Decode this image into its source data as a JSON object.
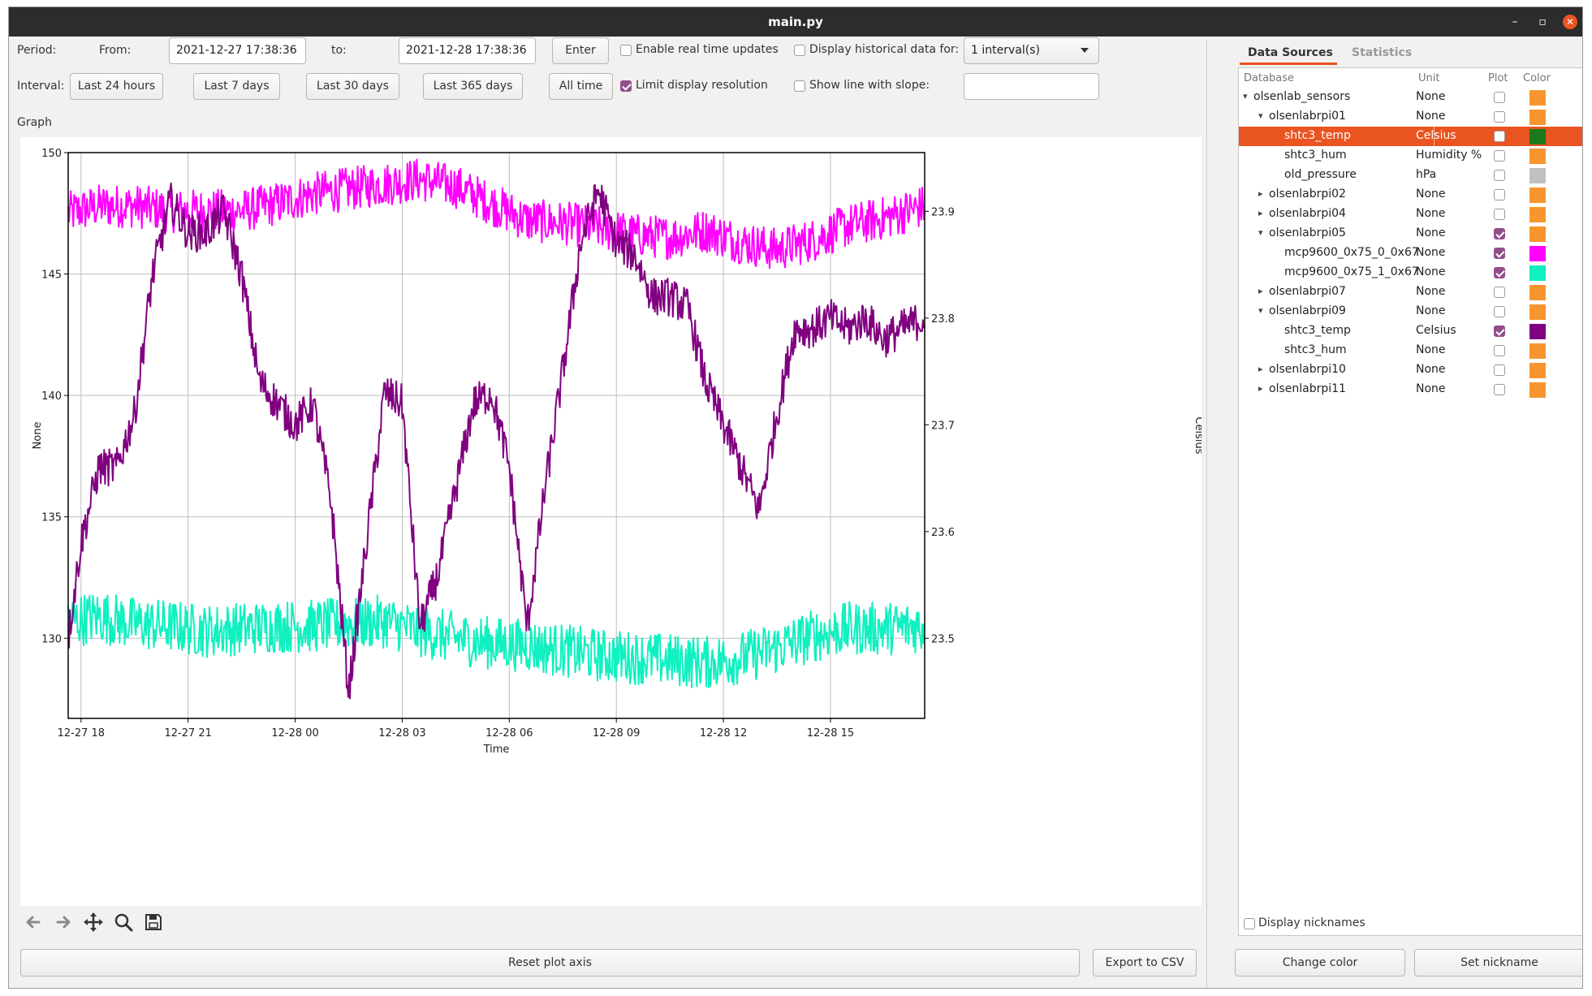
{
  "window": {
    "title": "main.py",
    "min_glyph": "–",
    "max_glyph": "▫",
    "close_glyph": "✕"
  },
  "controls": {
    "period_label": "Period:",
    "from_label": "From:",
    "from_value": "2021-12-27 17:38:36",
    "to_label": "to:",
    "to_value": "2021-12-28 17:38:36",
    "enter_label": "Enter",
    "realtime_label": "Enable real time updates",
    "realtime_checked": false,
    "historical_label": "Display historical data for:",
    "historical_checked": false,
    "historical_value": "1 interval(s)",
    "interval_label": "Interval:",
    "interval_buttons": [
      "Last 24 hours",
      "Last 7 days",
      "Last 30 days",
      "Last 365 days",
      "All time"
    ],
    "limit_label": "Limit display resolution",
    "limit_checked": true,
    "slope_label": "Show line with slope:",
    "slope_checked": false,
    "slope_value": "",
    "graph_label": "Graph"
  },
  "toolbar": {
    "icons": [
      "back-arrow-icon",
      "forward-arrow-icon",
      "pan-icon",
      "zoom-icon",
      "save-icon"
    ]
  },
  "buttons": {
    "reset_label": "Reset plot axis",
    "export_label": "Export to CSV",
    "change_color_label": "Change color",
    "set_nickname_label": "Set nickname"
  },
  "panel": {
    "tabs": [
      "Data Sources",
      "Statistics"
    ],
    "active_tab": 0,
    "columns": [
      "Database",
      "Unit",
      "Plot",
      "Color"
    ],
    "rows": [
      {
        "name": "olsenlab_sensors",
        "unit": "None",
        "level": 0,
        "arrow": "down",
        "plot": false,
        "color": "#f7962f"
      },
      {
        "name": "olsenlabrpi01",
        "unit": "None",
        "level": 1,
        "arrow": "down",
        "plot": false,
        "color": "#f7962f"
      },
      {
        "name": "shtc3_temp",
        "unit": "Celsius",
        "level": 2,
        "arrow": "",
        "plot": false,
        "color": "#1b7a1b",
        "selected": true
      },
      {
        "name": "shtc3_hum",
        "unit": "Humidity %",
        "level": 2,
        "arrow": "",
        "plot": false,
        "color": "#f7962f"
      },
      {
        "name": "old_pressure",
        "unit": "hPa",
        "level": 2,
        "arrow": "",
        "plot": false,
        "color": "#c0c0c0"
      },
      {
        "name": "olsenlabrpi02",
        "unit": "None",
        "level": 1,
        "arrow": "right",
        "plot": false,
        "color": "#f7962f"
      },
      {
        "name": "olsenlabrpi04",
        "unit": "None",
        "level": 1,
        "arrow": "right",
        "plot": false,
        "color": "#f7962f"
      },
      {
        "name": "olsenlabrpi05",
        "unit": "None",
        "level": 1,
        "arrow": "down",
        "plot": true,
        "color": "#f7962f"
      },
      {
        "name": "mcp9600_0x75_0_0x67",
        "unit": "None",
        "level": 2,
        "arrow": "",
        "plot": true,
        "color": "#ff00ff"
      },
      {
        "name": "mcp9600_0x75_1_0x67",
        "unit": "None",
        "level": 2,
        "arrow": "",
        "plot": true,
        "color": "#10f0c0"
      },
      {
        "name": "olsenlabrpi07",
        "unit": "None",
        "level": 1,
        "arrow": "right",
        "plot": false,
        "color": "#f7962f"
      },
      {
        "name": "olsenlabrpi09",
        "unit": "None",
        "level": 1,
        "arrow": "down",
        "plot": false,
        "color": "#f7962f"
      },
      {
        "name": "shtc3_temp",
        "unit": "Celsius",
        "level": 2,
        "arrow": "",
        "plot": true,
        "color": "#800080"
      },
      {
        "name": "shtc3_hum",
        "unit": "None",
        "level": 2,
        "arrow": "",
        "plot": false,
        "color": "#f7962f"
      },
      {
        "name": "olsenlabrpi10",
        "unit": "None",
        "level": 1,
        "arrow": "right",
        "plot": false,
        "color": "#f7962f"
      },
      {
        "name": "olsenlabrpi11",
        "unit": "None",
        "level": 1,
        "arrow": "right",
        "plot": false,
        "color": "#f7962f"
      }
    ],
    "nicknames_label": "Display nicknames",
    "nicknames_checked": false
  },
  "chart_data": {
    "type": "line",
    "xlabel": "Time",
    "ylabel": "None",
    "y2label": "Celsius",
    "x_ticks": [
      "12-27 18",
      "12-27 21",
      "12-28 00",
      "12-28 03",
      "12-28 06",
      "12-28 09",
      "12-28 12",
      "12-28 15"
    ],
    "x_range_hours": [
      17.64,
      41.64
    ],
    "x_tick_hours": [
      18,
      21,
      24,
      27,
      30,
      33,
      36,
      39
    ],
    "ylim": [
      126.7,
      150
    ],
    "y_ticks": [
      130,
      135,
      140,
      145,
      150
    ],
    "y2lim": [
      23.425,
      23.955
    ],
    "y2_ticks": [
      23.5,
      23.6,
      23.7,
      23.8,
      23.9
    ],
    "grid": true,
    "series": [
      {
        "name": "mcp9600_0x75_0_0x67",
        "axis": "left",
        "color": "#ff00ff",
        "x": [
          17.64,
          18.5,
          19.5,
          20.5,
          21.5,
          22.5,
          23.5,
          24.5,
          25.5,
          26.5,
          27.5,
          28.5,
          29.5,
          30.5,
          31.5,
          32.5,
          33.5,
          34.5,
          35.5,
          36.5,
          37.5,
          38.5,
          39.5,
          40.5,
          41.64
        ],
        "values": [
          147.5,
          147.8,
          147.8,
          147.6,
          147.6,
          147.6,
          147.9,
          148.3,
          148.5,
          148.7,
          148.9,
          148.6,
          147.9,
          147.2,
          147.1,
          146.9,
          146.6,
          146.5,
          146.8,
          146.3,
          146.0,
          146.4,
          147.0,
          147.3,
          147.8
        ],
        "noise": 0.9
      },
      {
        "name": "mcp9600_0x75_1_0x67",
        "axis": "left",
        "color": "#10f0c0",
        "x": [
          17.64,
          18.5,
          19.5,
          20.5,
          21.5,
          22.5,
          23.5,
          24.5,
          25.5,
          26.5,
          27.5,
          28.5,
          29.5,
          30.5,
          31.5,
          32.5,
          33.5,
          34.5,
          35.5,
          36.5,
          37.5,
          38.5,
          39.5,
          40.5,
          41.64
        ],
        "values": [
          130.7,
          130.9,
          130.6,
          130.5,
          130.3,
          130.4,
          130.5,
          130.5,
          130.6,
          130.7,
          130.3,
          130.0,
          129.8,
          129.7,
          129.5,
          129.3,
          129.2,
          129.1,
          129.0,
          129.2,
          129.6,
          130.1,
          130.4,
          130.4,
          130.5
        ],
        "noise": 1.1
      },
      {
        "name": "shtc3_temp",
        "axis": "right",
        "color": "#800080",
        "x": [
          17.64,
          18.0,
          18.5,
          19.0,
          19.5,
          20.0,
          20.5,
          21.0,
          21.5,
          22.0,
          22.5,
          23.0,
          23.5,
          24.0,
          24.5,
          25.0,
          25.5,
          26.0,
          26.5,
          27.0,
          27.5,
          28.0,
          28.5,
          29.0,
          29.5,
          30.0,
          30.5,
          31.0,
          31.5,
          32.0,
          32.5,
          33.0,
          33.5,
          34.0,
          34.5,
          35.0,
          35.5,
          36.0,
          36.5,
          37.0,
          37.5,
          38.0,
          38.5,
          39.0,
          39.5,
          40.0,
          40.5,
          41.0,
          41.64
        ],
        "values": [
          23.5,
          23.59,
          23.66,
          23.66,
          23.71,
          23.84,
          23.91,
          23.88,
          23.88,
          23.9,
          23.84,
          23.74,
          23.72,
          23.7,
          23.72,
          23.63,
          23.45,
          23.59,
          23.73,
          23.72,
          23.51,
          23.56,
          23.64,
          23.72,
          23.73,
          23.66,
          23.51,
          23.64,
          23.75,
          23.87,
          23.92,
          23.87,
          23.86,
          23.82,
          23.82,
          23.81,
          23.74,
          23.7,
          23.66,
          23.62,
          23.71,
          23.79,
          23.79,
          23.8,
          23.79,
          23.8,
          23.78,
          23.79,
          23.8
        ],
        "noise": 0.018
      }
    ]
  }
}
